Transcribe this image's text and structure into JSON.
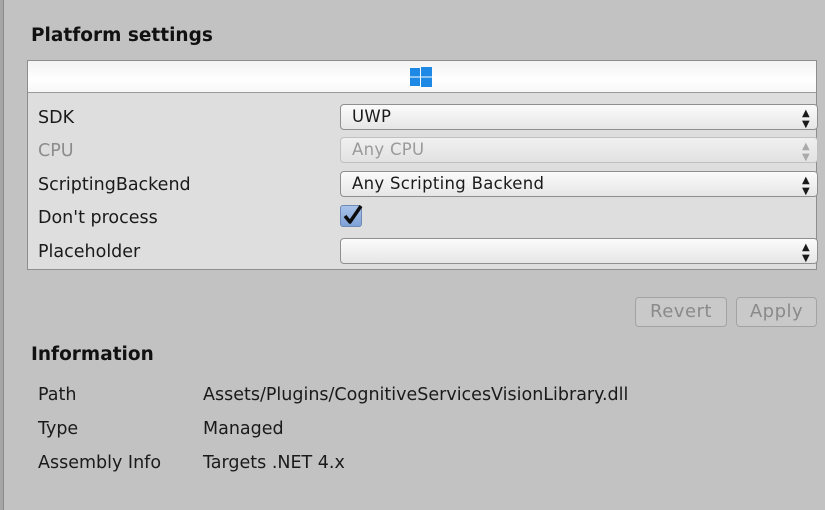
{
  "platform_settings": {
    "title": "Platform settings",
    "platform_tab_icon": "windows-logo-icon",
    "accent": "#1e88e5",
    "rows": [
      {
        "label": "SDK",
        "value": "UWP",
        "type": "dropdown",
        "enabled": true
      },
      {
        "label": "CPU",
        "value": "Any CPU",
        "type": "dropdown",
        "enabled": false
      },
      {
        "label": "ScriptingBackend",
        "value": "Any Scripting Backend",
        "type": "dropdown",
        "enabled": true
      },
      {
        "label": "Don't process",
        "checked": true,
        "type": "checkbox",
        "enabled": true
      },
      {
        "label": "Placeholder",
        "value": "",
        "type": "dropdown",
        "enabled": true
      }
    ]
  },
  "buttons": {
    "revert": "Revert",
    "apply": "Apply"
  },
  "information": {
    "title": "Information",
    "rows": [
      {
        "label": "Path",
        "value": "Assets/Plugins/CognitiveServicesVisionLibrary.dll"
      },
      {
        "label": "Type",
        "value": "Managed"
      },
      {
        "label": "Assembly Info",
        "value": "Targets .NET 4.x"
      }
    ]
  }
}
